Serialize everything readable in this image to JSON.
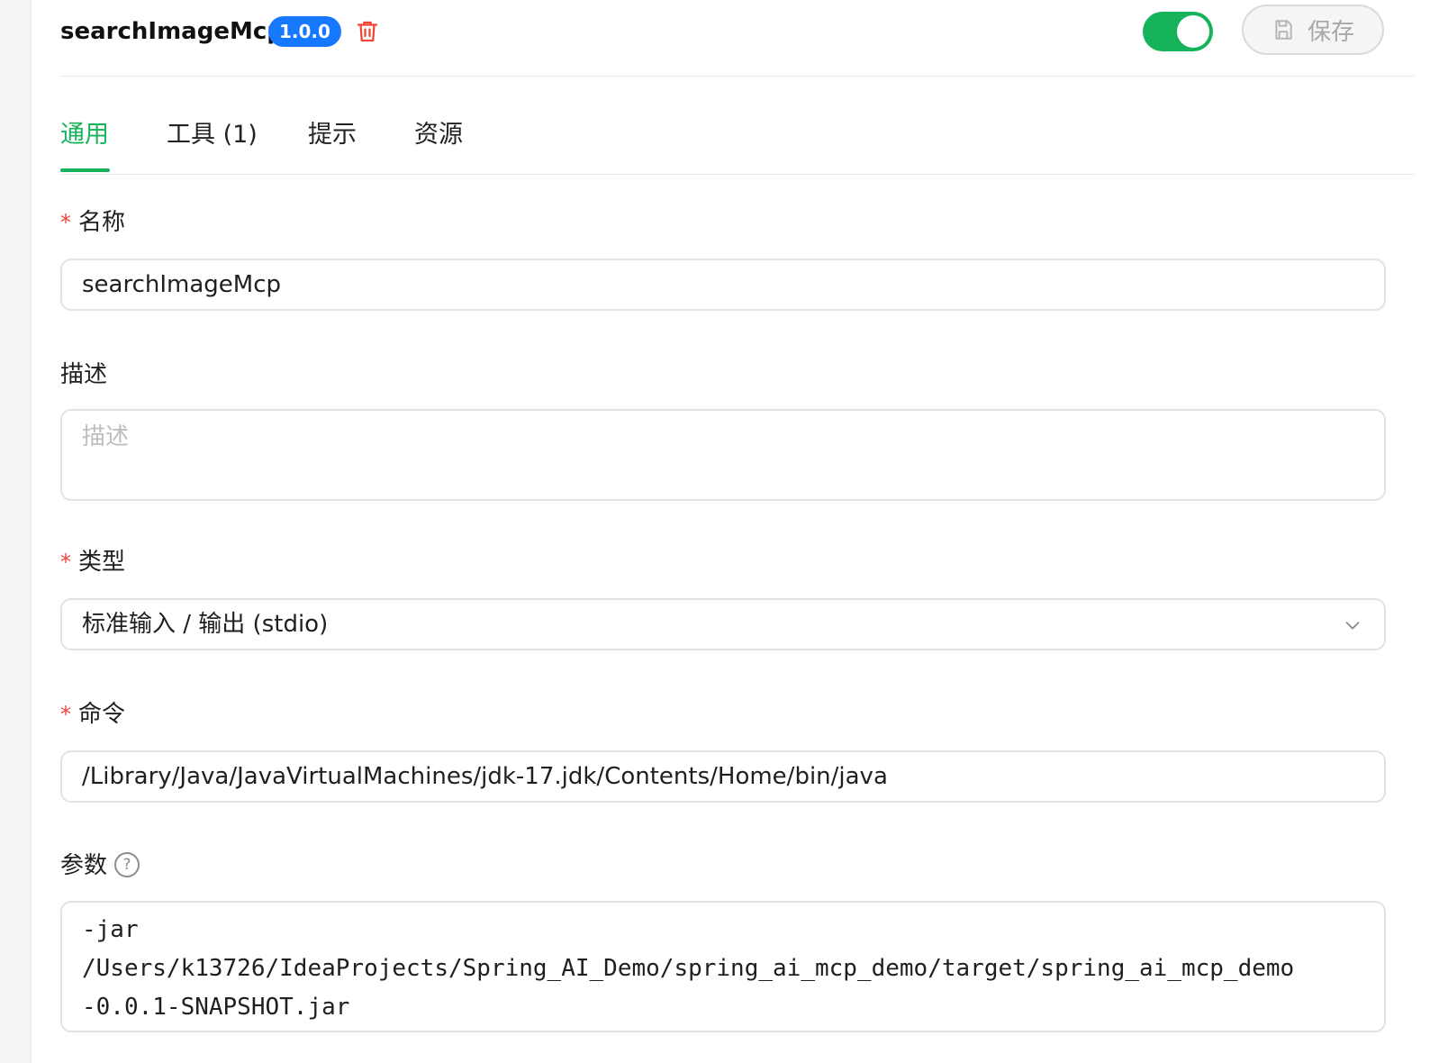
{
  "header": {
    "title": "searchImageMcp",
    "version": "1.0.0",
    "save_label": "保存",
    "enabled": true
  },
  "tabs": [
    {
      "label": "通用",
      "active": true
    },
    {
      "label": "工具 (1)",
      "active": false
    },
    {
      "label": "提示",
      "active": false
    },
    {
      "label": "资源",
      "active": false
    }
  ],
  "form": {
    "name": {
      "label": "名称",
      "required": true,
      "value": "searchImageMcp"
    },
    "description": {
      "label": "描述",
      "required": false,
      "placeholder": "描述",
      "value": ""
    },
    "type": {
      "label": "类型",
      "required": true,
      "value": "标准输入 / 输出 (stdio)"
    },
    "command": {
      "label": "命令",
      "required": true,
      "value": "/Library/Java/JavaVirtualMachines/jdk-17.jdk/Contents/Home/bin/java"
    },
    "args": {
      "label": "参数",
      "required": false,
      "line1": "-jar",
      "line2": "/Users/k13726/IdeaProjects/Spring_AI_Demo/spring_ai_mcp_demo/target/spring_ai_mcp_demo",
      "line3": "-0.0.1-SNAPSHOT.jar"
    }
  },
  "colors": {
    "accent": "#16b35a",
    "badge": "#1677ff",
    "danger": "#f04438"
  }
}
